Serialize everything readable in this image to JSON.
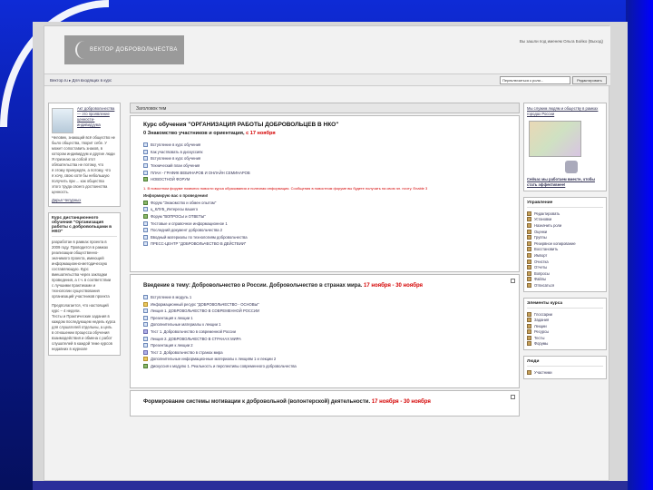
{
  "header": {
    "logo_text": "ВЕКТОР ДОБРОВОЛЬЧЕСТВА",
    "login_info": "Вы зашли под именем Ольга Бойко (Выход)"
  },
  "navbar": {
    "breadcrumb": "Вектор.ru ▸ Для входящих в курс",
    "role_select": "Переключиться к роли...",
    "edit_button": "Редактировать"
  },
  "left": {
    "block1_heading": "Акт добровольчества — это проявление ценности-индивидуума",
    "block1_body": [
      "Человек, знающий всё общество не",
      "было общества, творит себе. У",
      "может сопоставить знаков, в",
      "котором индивидуум и другие люди",
      "Я признаю за собой этот",
      "обязательства не потому, что",
      "я этому принуждён, а потому, что",
      "я хочу, свою хотя бы небольшую",
      "получить при ... как общества",
      "этого труда своего достоинства",
      "ценность."
    ],
    "block1_author": "Дарья Чепурных",
    "block2_title": "Курс дистанционного обучения \"Организация работы с добровольцами в НКО\"",
    "block2_body": [
      "разработан в рамках проекта в",
      "2009 году. Проводится в рамках",
      "реализации общественно-",
      "значимого проекта, имеющей",
      "информационно-методическую",
      "составляющую. Курс",
      "вмешательства через закладки",
      "проведения, а т.ч. в соответствии",
      "с лучшими практиками и",
      "технологии существования",
      "организаций участников проекта"
    ],
    "block2_footer": [
      "Предполагается, что настоящий",
      "курс – 4 недели.",
      "Тесты и Практические задания в",
      "каждом последующем недель курса",
      "для слушателей отдельны, а цель",
      "в отношении процесса обучения",
      "взаимодействия и обмена с работ",
      "слушателей в каждой теме курсов",
      "недавних в журнале"
    ]
  },
  "main": {
    "header": "Заголовок тем",
    "course_title": "Курс обучения \"ОРГАНИЗАЦИЯ РАБОТЫ ДОБРОВОЛЬЦЕВ В НКО\"",
    "intro_title": "0 Знакомство участников и ориентация, ",
    "intro_date": "с 17 ноября",
    "intro_items": [
      "Вступление в курс обучения",
      "Как участвовать в дискуссиях",
      "Вступление в курс обучения",
      "Технический план обучения",
      "ПЛАН - ГРАФИК ВЕБИНАРОВ И ОНЛАЙН СЕМИНАРОВ",
      "НОВОСТНОЙ ФОРУМ"
    ],
    "red_note": "1. В новостном форуме появятся новости курса образования и полезная информация. Сообщения в новостном форуме вы будете получать на свою эл. почту. Enable 3",
    "invite_note": "Информирую вас о проведении!",
    "forum_items": [
      "Форум \"Знакомство и обмен опытом\"",
      "ц_КЛУБ_Интересы вашего",
      "Форум \"ВОПРОСЫ и ОТВЕТЫ\"",
      "Тестовые и справочное информационное 1",
      "Последний документ добровольчества 2",
      "Вводный материалы по технологиям добровольчества",
      "ПРЕСС-ЦЕНТР \"ДОБРОВОЛЬЧЕСТВО В ДЕЙСТВИИ\""
    ],
    "topic1_title": "Введение в тему: Добровольчество в России. Добровольчество в странах мира. ",
    "topic1_date": "17 ноября - 30 ноября",
    "topic1_items": [
      "Вступление в модуль 1",
      "Информационный ресурс \"ДОБРОВОЛЬЧЕСТВО - ОСНОВЫ\"",
      "Лекция 1. ДОБРОВОЛЬЧЕСТВО В СОВРЕМЕННОЙ РОССИИ",
      "Презентация к лекции 1",
      "Дополнительные материалы к лекции 1",
      "Тест 1. Добровольчество в современной России",
      "Лекция 2. ДОБРОВОЛЬЧЕСТВО В СТРАНАХ МИРА",
      "Презентация к лекции 2",
      "Тест 2. Добровольчество в странах мира",
      "Дополнительные информационные материалы к лекциям 1 и лекции 2",
      "Дискуссия к модулю 1. Реальность и перспективы современного добровольчества"
    ],
    "topic2_title": "Формирование системы мотивации к добровольной (волонтерской) деятельности. ",
    "topic2_date": "17 ноября - 30 ноября"
  },
  "right": {
    "map_caption": "Мы служим людям и обществу в рамках городах России",
    "map_link": "Сейчас мы работаем вместе, чтобы стать эффективнее!",
    "admin_title": "Управление",
    "admin_items": [
      "Редактировать",
      "Установки",
      "Назначить роли",
      "Оценки",
      "Группы",
      "Резервное копирование",
      "Восстановить",
      "Импорт",
      "Очистка",
      "Отчеты",
      "Вопросы",
      "Файлы",
      "Отписаться"
    ],
    "elements_title": "Элементы курса",
    "elements_items": [
      "Глоссарии",
      "Задания",
      "Лекции",
      "Ресурсы",
      "Тесты",
      "Форумы"
    ],
    "people_title": "Люди",
    "people_items": [
      "Участники"
    ]
  }
}
